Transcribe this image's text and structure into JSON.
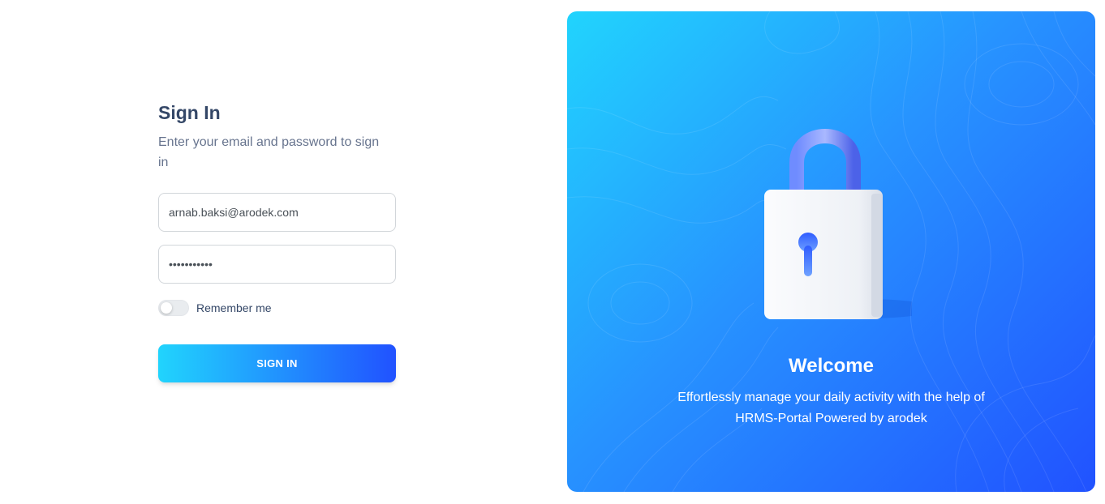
{
  "signin": {
    "title": "Sign In",
    "subtitle": "Enter your email and password to sign in",
    "email_value": "arnab.baksi@arodek.com",
    "password_value": "•••••••••••",
    "remember_label": "Remember me",
    "remember_checked": false,
    "button_label": "SIGN IN"
  },
  "welcome": {
    "title": "Welcome",
    "text": "Effortlessly manage your daily activity with the help of HRMS-Portal Powered by arodek",
    "illustration_icon": "padlock-icon"
  },
  "colors": {
    "heading": "#344767",
    "muted": "#67748e",
    "gradient_start": "#21d4fd",
    "gradient_end": "#2152ff"
  }
}
